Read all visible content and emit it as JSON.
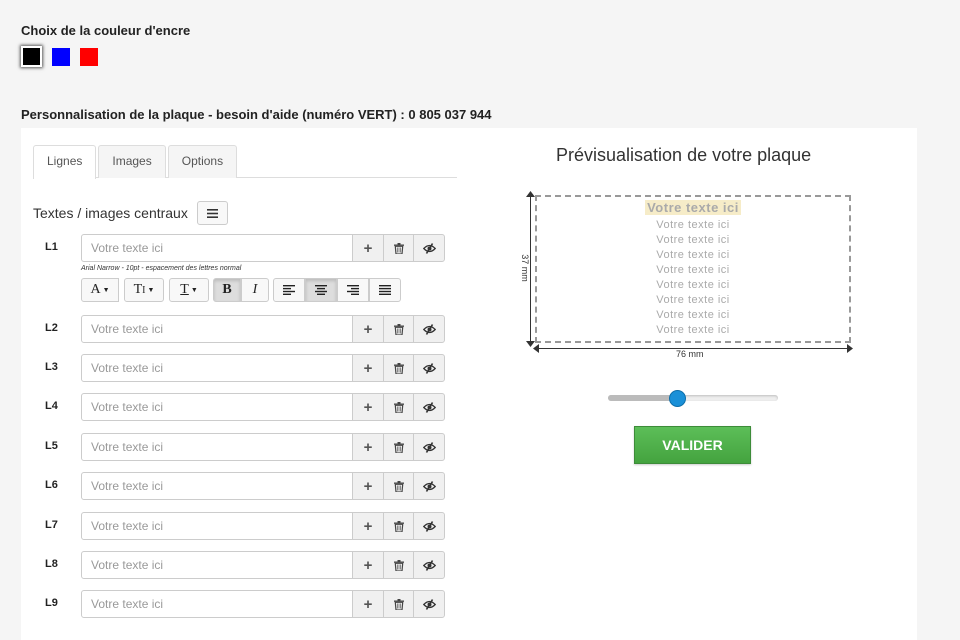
{
  "ink": {
    "title": "Choix de la couleur d'encre",
    "colors": [
      "#000000",
      "#0000ff",
      "#ff0000"
    ],
    "selected_index": 0
  },
  "personalisation": {
    "title": "Personnalisation de la plaque - besoin d'aide (numéro VERT) : 0 805 037 944"
  },
  "tabs": [
    {
      "label": "Lignes",
      "active": true
    },
    {
      "label": "Images",
      "active": false
    },
    {
      "label": "Options",
      "active": false
    }
  ],
  "central": {
    "label": "Textes / images centraux",
    "menu_icon": "hamburger-icon"
  },
  "rows": [
    {
      "label": "L1",
      "placeholder": "Votre texte ici"
    },
    {
      "label": "L2",
      "placeholder": "Votre texte ici"
    },
    {
      "label": "L3",
      "placeholder": "Votre texte ici"
    },
    {
      "label": "L4",
      "placeholder": "Votre texte ici"
    },
    {
      "label": "L5",
      "placeholder": "Votre texte ici"
    },
    {
      "label": "L6",
      "placeholder": "Votre texte ici"
    },
    {
      "label": "L7",
      "placeholder": "Votre texte ici"
    },
    {
      "label": "L8",
      "placeholder": "Votre texte ici"
    },
    {
      "label": "L9",
      "placeholder": "Votre texte ici"
    }
  ],
  "row_actions": {
    "add_icon": "plus-icon",
    "delete_icon": "trash-icon",
    "hide_icon": "eye-slash-icon"
  },
  "font_info": "Arial Narrow - 10pt - espacement des lettres normal",
  "format_toolbar": {
    "font_family": "A",
    "font_size": "T",
    "letter_spacing": "T",
    "bold": "B",
    "italic": "I",
    "bold_pressed": true,
    "align_center_pressed": true
  },
  "preview": {
    "title": "Prévisualisation de votre plaque",
    "lines": [
      "Votre texte ici",
      "Votre texte ici",
      "Votre texte ici",
      "Votre texte ici",
      "Votre texte ici",
      "Votre texte ici",
      "Votre texte ici",
      "Votre texte ici",
      "Votre texte ici"
    ],
    "height_label": "37 mm",
    "width_label": "76 mm"
  },
  "zoom_slider": {
    "value": 0.4
  },
  "validate_label": "VALIDER",
  "colors": {
    "validate": "#4cae4c",
    "slider_thumb": "#1a90d8"
  }
}
